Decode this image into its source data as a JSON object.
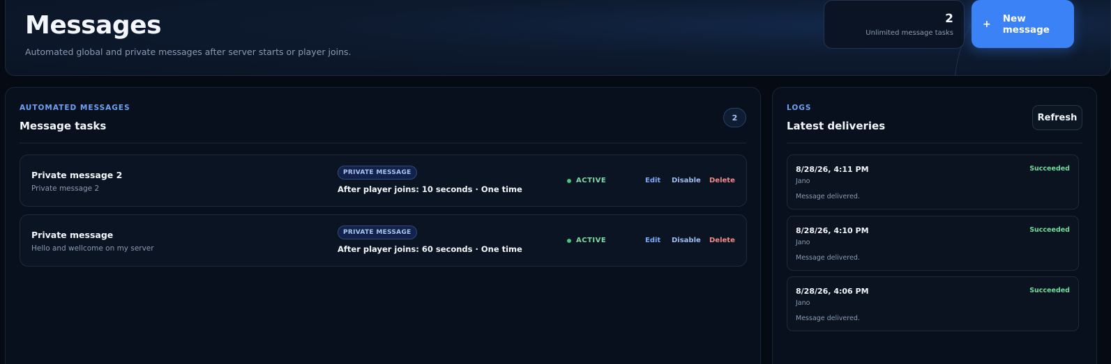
{
  "header": {
    "title": "Messages",
    "subtitle": "Automated global and private messages after server starts or player joins.",
    "stat": {
      "value": "2",
      "label": "Unlimited message tasks"
    },
    "new_button": {
      "icon": "plus-icon",
      "label": "New message"
    }
  },
  "tasks_panel": {
    "eyebrow": "AUTOMATED MESSAGES",
    "title": "Message tasks",
    "count": "2",
    "tasks": [
      {
        "name": "Private message 2",
        "description": "Private message 2",
        "type": "PRIVATE MESSAGE",
        "schedule": "After player joins: 10 seconds · One time",
        "status": "ACTIVE",
        "edit": "Edit",
        "disable": "Disable",
        "delete": "Delete"
      },
      {
        "name": "Private message",
        "description": "Hello and wellcome on my server",
        "type": "PRIVATE MESSAGE",
        "schedule": "After player joins: 60 seconds · One time",
        "status": "ACTIVE",
        "edit": "Edit",
        "disable": "Disable",
        "delete": "Delete"
      }
    ]
  },
  "logs_panel": {
    "eyebrow": "LOGS",
    "title": "Latest deliveries",
    "refresh_label": "Refresh",
    "logs": [
      {
        "time": "8/28/26, 4:11 PM",
        "user": "Jano",
        "message": "Message delivered.",
        "status": "Succeeded"
      },
      {
        "time": "8/28/26, 4:10 PM",
        "user": "Jano",
        "message": "Message delivered.",
        "status": "Succeeded"
      },
      {
        "time": "8/28/26, 4:06 PM",
        "user": "Jano",
        "message": "Message delivered.",
        "status": "Succeeded"
      }
    ]
  },
  "colors": {
    "accent": "#3b82f6",
    "active": "#3fc87a",
    "success": "#6fdc9c",
    "danger": "#f08a8a"
  }
}
